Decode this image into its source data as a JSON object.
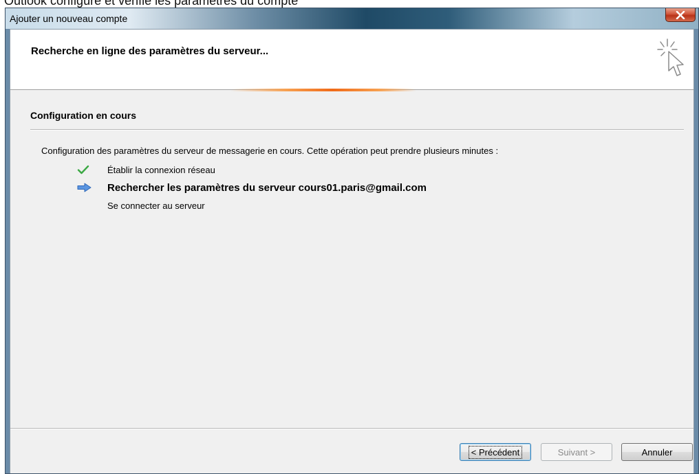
{
  "caption": "Outlook configure et vérifie les paramètres du compte",
  "window": {
    "title": "Ajouter un nouveau compte",
    "close_label": "x"
  },
  "header": {
    "title": "Recherche en ligne des paramètres du serveur..."
  },
  "section": {
    "title": "Configuration en cours",
    "description": "Configuration des paramètres du serveur de messagerie en cours. Cette opération peut prendre plusieurs minutes :"
  },
  "steps": [
    {
      "label": "Établir la connexion réseau",
      "status": "done",
      "icon": "checkmark-icon",
      "color": "#3aa843"
    },
    {
      "label": "Rechercher les paramètres du serveur cours01.paris@gmail.com",
      "status": "in-progress",
      "icon": "arrow-right-icon",
      "color": "#3b7fd9"
    },
    {
      "label": "Se connecter au serveur",
      "status": "pending",
      "icon": "",
      "color": ""
    }
  ],
  "buttons": {
    "prev": "< Précédent",
    "next": "Suivant >",
    "cancel": "Annuler"
  }
}
